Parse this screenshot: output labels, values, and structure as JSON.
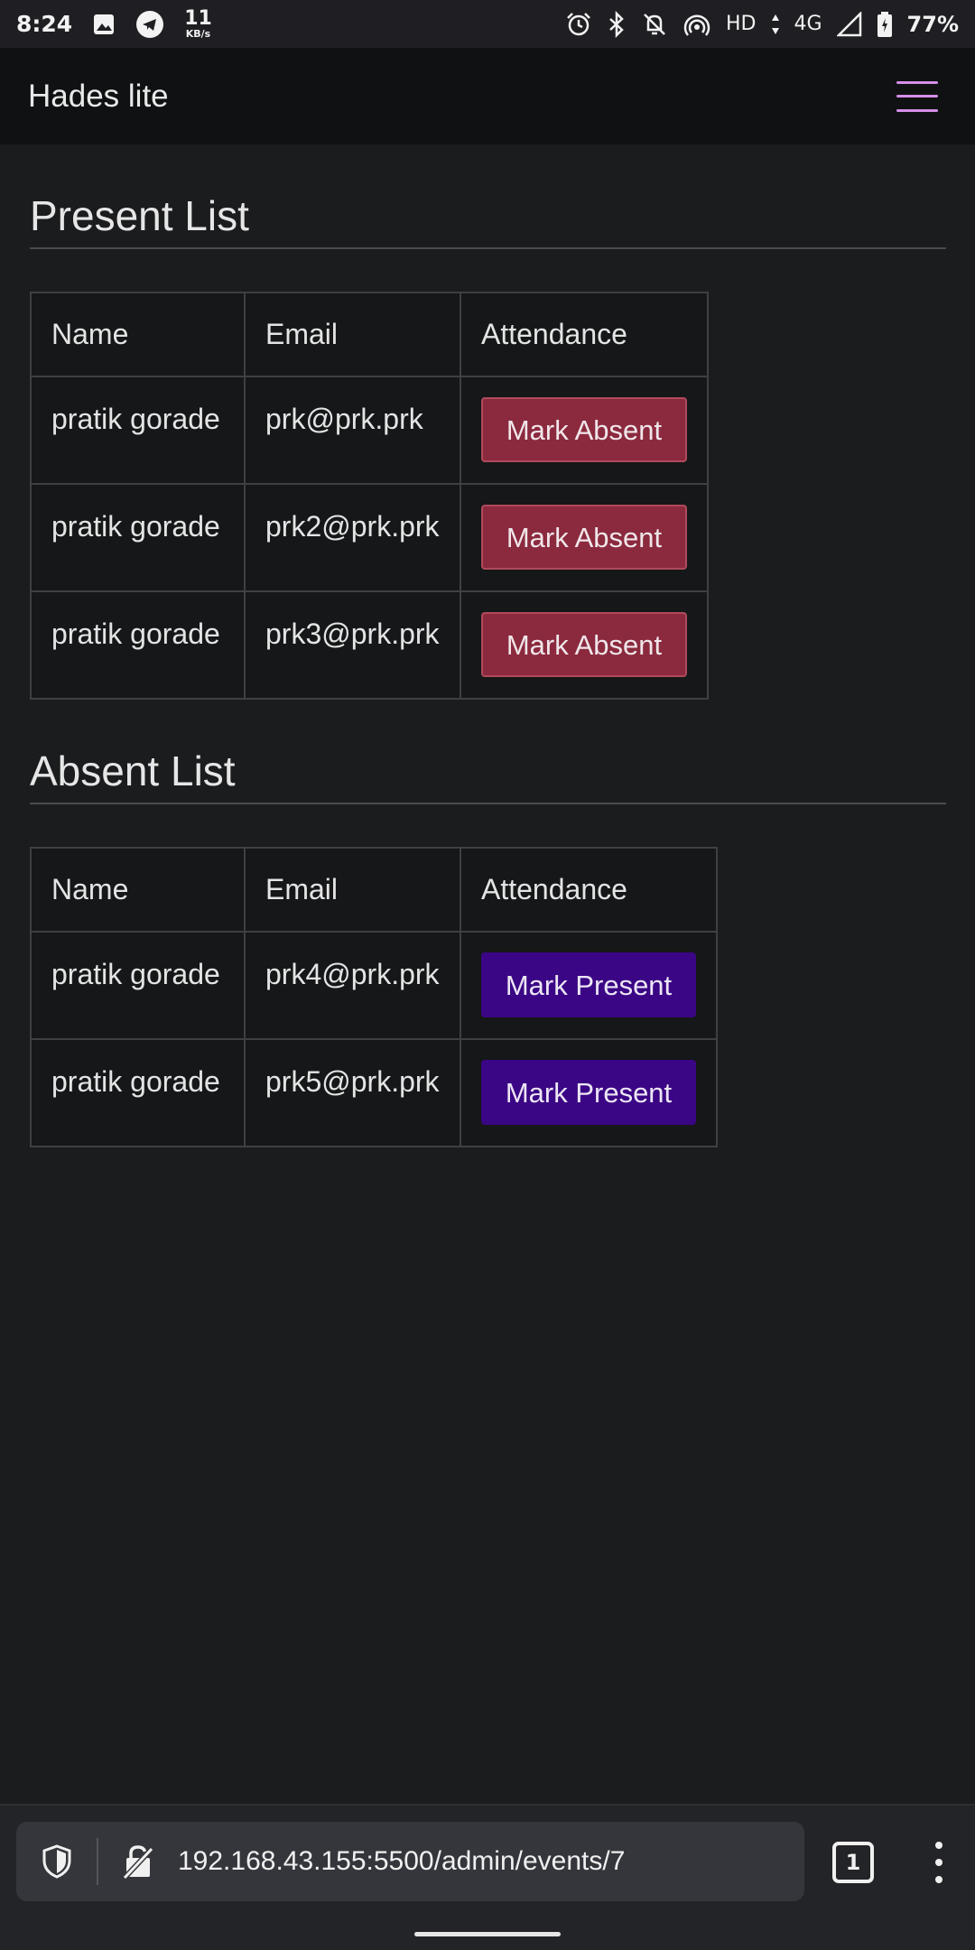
{
  "status_bar": {
    "time": "8:24",
    "net_speed": "11",
    "net_speed_unit": "KB/s",
    "hd": "HD",
    "network": "4G",
    "battery": "77%",
    "icons": [
      "image-icon",
      "telegram-icon",
      "alarm-icon",
      "bluetooth-icon",
      "mute-icon",
      "hotspot-icon",
      "signal-icon",
      "battery-icon"
    ]
  },
  "navbar": {
    "brand": "Hades lite",
    "menu_icon": "hamburger-icon",
    "accent_color": "#d68ee8"
  },
  "present": {
    "title": "Present List",
    "headers": [
      "Name",
      "Email",
      "Attendance"
    ],
    "rows": [
      {
        "name": "pratik gorade",
        "email": "prk@prk.prk",
        "action": "Mark Absent"
      },
      {
        "name": "pratik gorade",
        "email": "prk2@prk.prk",
        "action": "Mark Absent"
      },
      {
        "name": "pratik gorade",
        "email": "prk3@prk.prk",
        "action": "Mark Absent"
      }
    ],
    "button_color": "#8b2a3e"
  },
  "absent": {
    "title": "Absent List",
    "headers": [
      "Name",
      "Email",
      "Attendance"
    ],
    "rows": [
      {
        "name": "pratik gorade",
        "email": "prk4@prk.prk",
        "action": "Mark Present"
      },
      {
        "name": "pratik gorade",
        "email": "prk5@prk.prk",
        "action": "Mark Present"
      }
    ],
    "button_color": "#3b0685"
  },
  "browser": {
    "url": "192.168.43.155:5500/admin/events/7",
    "tab_count": "1",
    "icons": [
      "shield-icon",
      "insecure-lock-icon",
      "tabs-icon",
      "more-menu-icon"
    ]
  }
}
